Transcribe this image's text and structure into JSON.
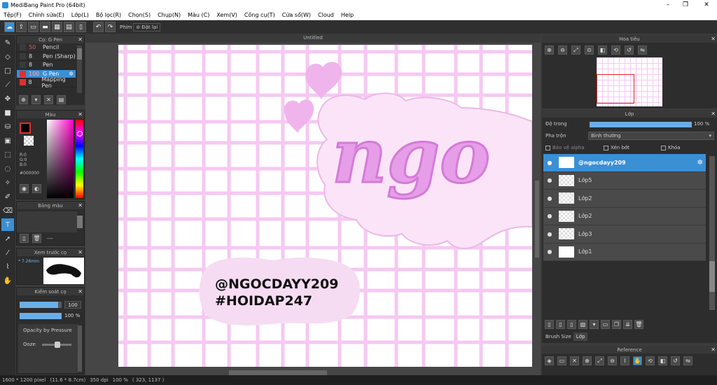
{
  "window": {
    "title": "MediBang Paint Pro (64bit)",
    "minimize": "–",
    "maximize": "❐",
    "close": "✕"
  },
  "menu": [
    "Tệp(F)",
    "Chỉnh sửa(E)",
    "Lớp(L)",
    "Bộ lọc(R)",
    "Chọn(S)",
    "Chụp(N)",
    "Màu (C)",
    "Xem(V)",
    "Công cụ(T)",
    "Cửa sổ(W)",
    "Cloud",
    "Help"
  ],
  "toolbar": {
    "key_label": "Phím",
    "redo_label": "Đặt lại"
  },
  "brush_panel": {
    "title": "Cọ: G Pen",
    "items": [
      {
        "size": "50",
        "name": "Pencil",
        "color": "#3a3a3a",
        "size_color": "#e06060"
      },
      {
        "size": "8",
        "name": "Pen (Sharp)",
        "color": "#3a3a3a",
        "size_color": "#dddddd"
      },
      {
        "size": "8",
        "name": "Pen",
        "color": "#3a3a3a",
        "size_color": "#dddddd"
      },
      {
        "size": "100",
        "name": "G Pen",
        "color": "#e03030",
        "size_color": "#ff9090",
        "selected": true
      },
      {
        "size": "8",
        "name": "Mapping Pen",
        "color": "#e03030",
        "size_color": "#dddddd"
      }
    ]
  },
  "color_panel": {
    "title": "Màu",
    "r": "R:0",
    "g": "G:0",
    "b": "B:0",
    "hex": "#000000"
  },
  "palette_panel": {
    "title": "Bảng màu",
    "dash": "---"
  },
  "preview_panel": {
    "title": "Xem trước cọ",
    "size": "7.26mm"
  },
  "control_panel": {
    "title": "Kiểm soát cọ",
    "size_value": "100",
    "opacity_value": "100 %",
    "pressure_label": "Opacity by Pressure",
    "ooze_label": "Ooze",
    "size_level": 0.92,
    "opacity_level": 1.0
  },
  "canvas": {
    "tab": "Untitled",
    "word": "ngo",
    "line1": "@NGOCDAYY209",
    "line2": "#HOIDAP247"
  },
  "navigator": {
    "title": "Hoa tiêu"
  },
  "layer_panel": {
    "title": "Lớp",
    "opacity_label": "Độ trong",
    "opacity_value": "100 %",
    "blend_label": "Pha trộn",
    "blend_value": "Bình thường",
    "protect_alpha": "Bảo vệ alpha",
    "clipping": "Xén bớt",
    "lock": "Khóa",
    "layers": [
      {
        "name": "@ngocdayy209",
        "selected": true
      },
      {
        "name": "Lớp5"
      },
      {
        "name": "Lớp2"
      },
      {
        "name": "Lớp2"
      },
      {
        "name": "Lớp3"
      },
      {
        "name": "Lớp1"
      }
    ]
  },
  "tabs": {
    "brush_size": "Brush Size",
    "layer": "Lớp"
  },
  "reference_panel": {
    "title": "Reference"
  },
  "status": {
    "size": "1600 * 1200 pixel",
    "cm": "(11.6 * 8.7cm)",
    "dpi": "350 dpi",
    "zoom": "100 %",
    "coords": "( 323, 1137 )"
  }
}
